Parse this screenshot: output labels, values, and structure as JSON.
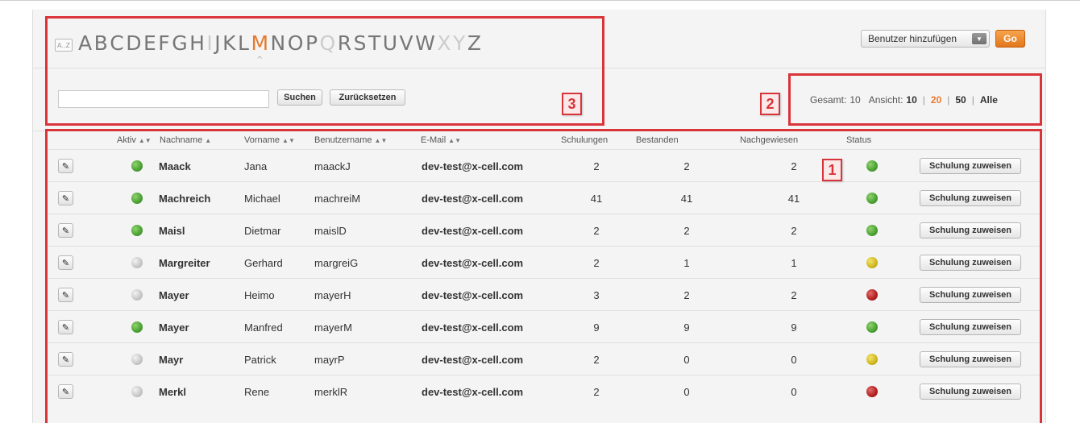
{
  "alphabet": {
    "az_icon": "A..Z",
    "letters": [
      {
        "char": "A",
        "enabled": true
      },
      {
        "char": "B",
        "enabled": true
      },
      {
        "char": "C",
        "enabled": true
      },
      {
        "char": "D",
        "enabled": true
      },
      {
        "char": "E",
        "enabled": true
      },
      {
        "char": "F",
        "enabled": true
      },
      {
        "char": "G",
        "enabled": true
      },
      {
        "char": "H",
        "enabled": true
      },
      {
        "char": "I",
        "enabled": false
      },
      {
        "char": "J",
        "enabled": true
      },
      {
        "char": "K",
        "enabled": true
      },
      {
        "char": "L",
        "enabled": true
      },
      {
        "char": "M",
        "enabled": true,
        "active": true
      },
      {
        "char": "N",
        "enabled": true
      },
      {
        "char": "O",
        "enabled": true
      },
      {
        "char": "P",
        "enabled": true
      },
      {
        "char": "Q",
        "enabled": false
      },
      {
        "char": "R",
        "enabled": true
      },
      {
        "char": "S",
        "enabled": true
      },
      {
        "char": "T",
        "enabled": true
      },
      {
        "char": "U",
        "enabled": true
      },
      {
        "char": "V",
        "enabled": true
      },
      {
        "char": "W",
        "enabled": true
      },
      {
        "char": "X",
        "enabled": false
      },
      {
        "char": "Y",
        "enabled": false
      },
      {
        "char": "Z",
        "enabled": true
      }
    ]
  },
  "search": {
    "value": "",
    "placeholder": "",
    "search_label": "Suchen",
    "reset_label": "Zurücksetzen"
  },
  "add_user": {
    "selected": "Benutzer hinzufügen",
    "go_label": "Go"
  },
  "pager": {
    "total_label": "Gesamt:",
    "total_value": "10",
    "view_label": "Ansicht:",
    "options": [
      "10",
      "20",
      "50",
      "Alle"
    ],
    "current": "20"
  },
  "annotations": [
    "1",
    "2",
    "3"
  ],
  "table": {
    "headers": {
      "aktiv": "Aktiv",
      "nachname": "Nachname",
      "vorname": "Vorname",
      "benutzername": "Benutzername",
      "email": "E-Mail",
      "schulungen": "Schulungen",
      "bestanden": "Bestanden",
      "nachgewiesen": "Nachgewiesen",
      "status": "Status"
    },
    "assign_label": "Schulung zuweisen",
    "rows": [
      {
        "active": "green",
        "lastname": "Maack",
        "firstname": "Jana",
        "username": "maackJ",
        "email": "dev-test@x-cell.com",
        "schulungen": "2",
        "bestanden": "2",
        "nachgewiesen": "2",
        "status": "green"
      },
      {
        "active": "green",
        "lastname": "Machreich",
        "firstname": "Michael",
        "username": "machreiM",
        "email": "dev-test@x-cell.com",
        "schulungen": "41",
        "bestanden": "41",
        "nachgewiesen": "41",
        "status": "green"
      },
      {
        "active": "green",
        "lastname": "Maisl",
        "firstname": "Dietmar",
        "username": "maislD",
        "email": "dev-test@x-cell.com",
        "schulungen": "2",
        "bestanden": "2",
        "nachgewiesen": "2",
        "status": "green"
      },
      {
        "active": "grey",
        "lastname": "Margreiter",
        "firstname": "Gerhard",
        "username": "margreiG",
        "email": "dev-test@x-cell.com",
        "schulungen": "2",
        "bestanden": "1",
        "nachgewiesen": "1",
        "status": "yellow"
      },
      {
        "active": "grey",
        "lastname": "Mayer",
        "firstname": "Heimo",
        "username": "mayerH",
        "email": "dev-test@x-cell.com",
        "schulungen": "3",
        "bestanden": "2",
        "nachgewiesen": "2",
        "status": "red"
      },
      {
        "active": "green",
        "lastname": "Mayer",
        "firstname": "Manfred",
        "username": "mayerM",
        "email": "dev-test@x-cell.com",
        "schulungen": "9",
        "bestanden": "9",
        "nachgewiesen": "9",
        "status": "green"
      },
      {
        "active": "grey",
        "lastname": "Mayr",
        "firstname": "Patrick",
        "username": "mayrP",
        "email": "dev-test@x-cell.com",
        "schulungen": "2",
        "bestanden": "0",
        "nachgewiesen": "0",
        "status": "yellow"
      },
      {
        "active": "grey",
        "lastname": "Merkl",
        "firstname": "Rene",
        "username": "merklR",
        "email": "dev-test@x-cell.com",
        "schulungen": "2",
        "bestanden": "0",
        "nachgewiesen": "0",
        "status": "red"
      }
    ]
  }
}
